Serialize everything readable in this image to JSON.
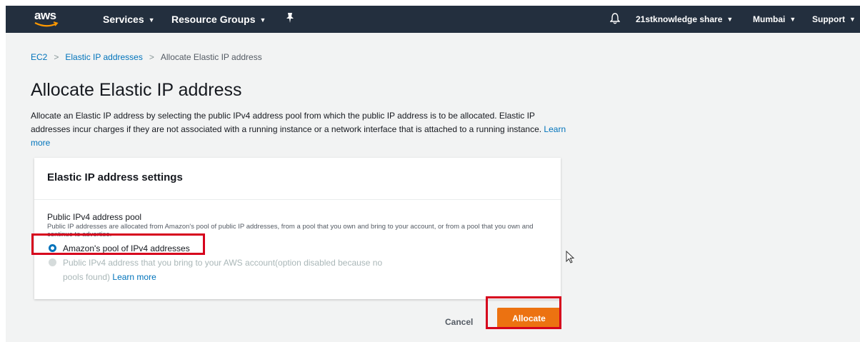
{
  "nav": {
    "logo": "aws",
    "services": "Services",
    "resource_groups": "Resource Groups",
    "account": "21stknowledge share",
    "region": "Mumbai",
    "support": "Support",
    "icons": [
      "pin-icon",
      "bell-icon"
    ]
  },
  "breadcrumb": {
    "item1": "EC2",
    "item2": "Elastic IP addresses",
    "item3": "Allocate Elastic IP address"
  },
  "page": {
    "title": "Allocate Elastic IP address",
    "description": "Allocate an Elastic IP address by selecting the public IPv4 address pool from which the public IP address is to be allocated. Elastic IP addresses incur charges if they are not associated with a running instance or a network interface that is attached to a running instance.",
    "learn_more": "Learn more"
  },
  "panel": {
    "title": "Elastic IP address settings",
    "field_label": "Public IPv4 address pool",
    "field_help": "Public IP addresses are allocated from Amazon's pool of public IP addresses, from a pool that you own and bring to your account, or from a pool that you own and continue to advertise.",
    "option1": "Amazon's pool of IPv4 addresses",
    "option2_line1": "Public IPv4 address that you bring to your AWS account(option disabled because no",
    "option2_line2": "pools found)",
    "option2_link": "Learn more"
  },
  "actions": {
    "cancel": "Cancel",
    "allocate": "Allocate"
  },
  "colors": {
    "nav_bg": "#232f3e",
    "link": "#0073bb",
    "primary_button": "#ec7211",
    "highlight": "#d6001c"
  }
}
